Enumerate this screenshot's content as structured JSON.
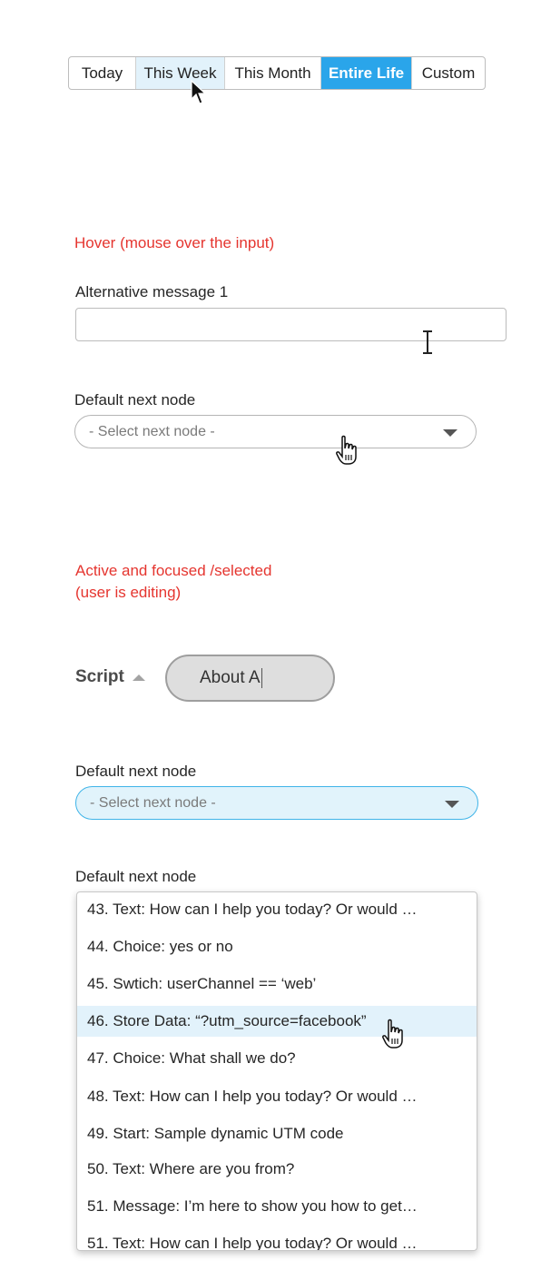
{
  "date_range": {
    "segments": [
      {
        "label": "Today",
        "state": "normal"
      },
      {
        "label": "This Week",
        "state": "hover"
      },
      {
        "label": "This Month",
        "state": "normal"
      },
      {
        "label": "Entire Life",
        "state": "active"
      },
      {
        "label": "Custom",
        "state": "normal"
      }
    ]
  },
  "hover_section": {
    "heading": "Hover (mouse over the input)",
    "alt_message_label": "Alternative message 1",
    "alt_message_value": "",
    "next_node_label": "Default next node",
    "next_node_placeholder": "- Select next node -"
  },
  "active_section": {
    "heading_line1": "Active and focused /selected",
    "heading_line2": "(user is editing)",
    "script_label": "Script",
    "script_value": "About A",
    "next_node_label": "Default next node",
    "next_node_placeholder": "- Select next node -",
    "dropdown_label": "Default next node",
    "options": [
      "43. Text: How can I help you today? Or would …",
      "44. Choice: yes or no",
      "45. Swtich: userChannel == ‘web’",
      "46. Store Data: “?utm_source=facebook”",
      "47. Choice: What shall we do?",
      "48. Text: How can I help you today? Or would …",
      "49. Start: Sample dynamic UTM code",
      "50. Text: Where are you from?",
      "51. Message: I’m here to show you how to get…",
      "51. Text: How can I help you today? Or would …"
    ],
    "highlighted_option": "46. Store Data: “?utm_source=facebook”"
  },
  "colors": {
    "accent": "#2aa5ea",
    "hover_bg": "#e2f2fb",
    "annotation_red": "#e5352f"
  }
}
